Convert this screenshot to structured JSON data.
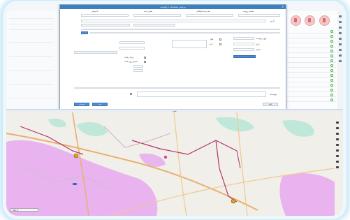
{
  "dialog": {
    "title": "ویرایش مشخصات درخواست",
    "close_label": "×",
    "header_fields": [
      "شماره پرونده",
      "نام و نام خانوادگی",
      "شماره ثبت",
      "کد پستی"
    ],
    "labels": [
      "آدرس:",
      "نوع درخواست:",
      "تاریخ:",
      "منطقه:",
      "توضیحات:"
    ],
    "checkbox_labels": [
      "فعال",
      "تایید",
      "ارسال پیامک",
      "نمایش روی نقشه"
    ],
    "buttons": {
      "save": "ثبت",
      "cancel": "انصراف",
      "confirm": "تایید"
    }
  },
  "map": {
    "header": "نقشه",
    "scale_label": "500 m"
  },
  "colors": {
    "title_bar": "#3d7fbf",
    "zone_fill": "#e6a8ef",
    "park_fill": "#bfe8da",
    "road_main": "#e9b070",
    "route_line": "#b3326a"
  },
  "icons": [
    "close-icon",
    "map-pin-icon",
    "zoom-icon",
    "layers-icon"
  ]
}
